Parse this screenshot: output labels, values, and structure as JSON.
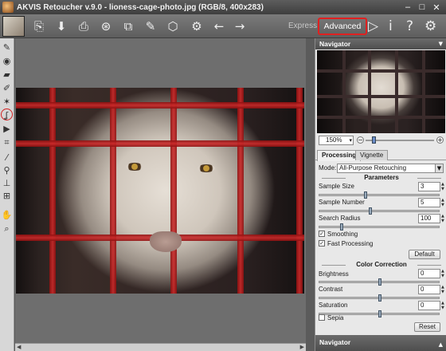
{
  "window": {
    "title": "AKVIS Retoucher v.9.0 - lioness-cage-photo.jpg (RGB/8, 400x283)",
    "controls": {
      "minimize": "–",
      "maximize": "□",
      "close": "✕"
    }
  },
  "toolbar": {
    "icons": [
      "open-icon",
      "save-icon",
      "print-icon",
      "share-icon",
      "batch-icon",
      "plugin-icon",
      "gear-cluster-icon",
      "back-icon",
      "forward-icon"
    ],
    "mode_express": "Express",
    "mode_advanced": "Advanced",
    "run": "▷",
    "info": "i",
    "help": "?",
    "settings": "⚙",
    "highlight_color": "#e02020"
  },
  "left_tools": [
    "selection-brush-icon",
    "target-icon",
    "eraser-icon",
    "pencil-icon",
    "star-icon",
    "lasso-icon",
    "run-icon",
    "crop-icon",
    "pipette-icon",
    "clone-icon",
    "stamp-icon",
    "patch-icon",
    "hand-icon",
    "zoom-icon"
  ],
  "navigator": {
    "title": "Navigator",
    "zoom": "150%",
    "zoom_minus": "−",
    "zoom_plus": "+",
    "zoom_level": 0.12
  },
  "tabs": [
    "Processing",
    "Vignette"
  ],
  "processing": {
    "mode_label": "Mode:",
    "mode_value": "All-Purpose Retouching",
    "parameters_heading": "Parameters",
    "sample_size_label": "Sample Size",
    "sample_size_value": "3",
    "sample_number_label": "Sample Number",
    "sample_number_value": "5",
    "search_radius_label": "Search Radius",
    "search_radius_value": "100",
    "smoothing_label": "Smoothing",
    "smoothing_checked": "✓",
    "fast_processing_label": "Fast Processing",
    "fast_processing_checked": "✓",
    "default_button": "Default",
    "color_correction_heading": "Color Correction",
    "brightness_label": "Brightness",
    "brightness_value": "0",
    "contrast_label": "Contrast",
    "contrast_value": "0",
    "saturation_label": "Saturation",
    "saturation_value": "0",
    "sepia_label": "Sepia",
    "sepia_checked": "",
    "reset_button": "Reset"
  },
  "bottom_panel": {
    "title": "Navigator"
  }
}
